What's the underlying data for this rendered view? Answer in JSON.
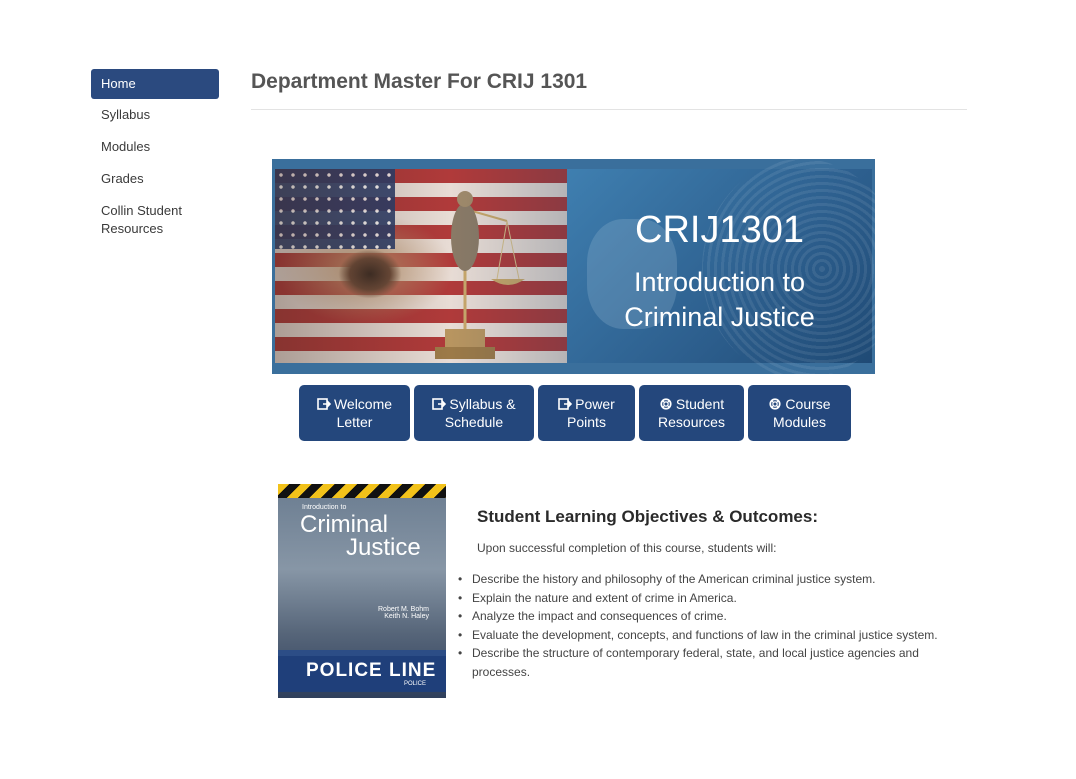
{
  "sidebar": {
    "items": [
      {
        "label": "Home",
        "active": true
      },
      {
        "label": "Syllabus"
      },
      {
        "label": "Modules"
      },
      {
        "label": "Grades"
      },
      {
        "label": "Collin Student Resources"
      }
    ]
  },
  "page": {
    "title": "Department Master For CRIJ 1301"
  },
  "banner": {
    "code": "CRIJ1301",
    "subtitle_line1": "Introduction to",
    "subtitle_line2": "Criminal Justice"
  },
  "buttons": [
    {
      "line1": "Welcome",
      "line2": "Letter",
      "icon": "external-link-icon"
    },
    {
      "line1": "Syllabus &",
      "line2": "Schedule",
      "icon": "external-link-icon"
    },
    {
      "line1": "Power",
      "line2": "Points",
      "icon": "external-link-icon"
    },
    {
      "line1": "Student",
      "line2": "Resources",
      "icon": "life-ring-icon"
    },
    {
      "line1": "Course",
      "line2": "Modules",
      "icon": "life-ring-icon"
    }
  ],
  "book": {
    "intro_text": "Introduction to",
    "title_line1": "Criminal",
    "title_line2": "Justice",
    "authors_line1": "Robert M. Bohm",
    "authors_line2": "Keith N. Haley",
    "tape_text": "POLICE LINE",
    "tape_sub": "POLICE"
  },
  "objectives": {
    "heading": "Student Learning Objectives & Outcomes:",
    "intro": "Upon successful completion of this course, students will:",
    "items": [
      "Describe the history and philosophy of the American criminal justice system.",
      "Explain the nature and extent of crime in America.",
      "Analyze the impact and consequences of crime.",
      "Evaluate the development, concepts, and functions of law in the criminal justice system.",
      "Describe the structure of contemporary federal, state, and local justice agencies and processes."
    ]
  },
  "colors": {
    "accent": "#24477c",
    "banner": "#3a6f9c"
  }
}
